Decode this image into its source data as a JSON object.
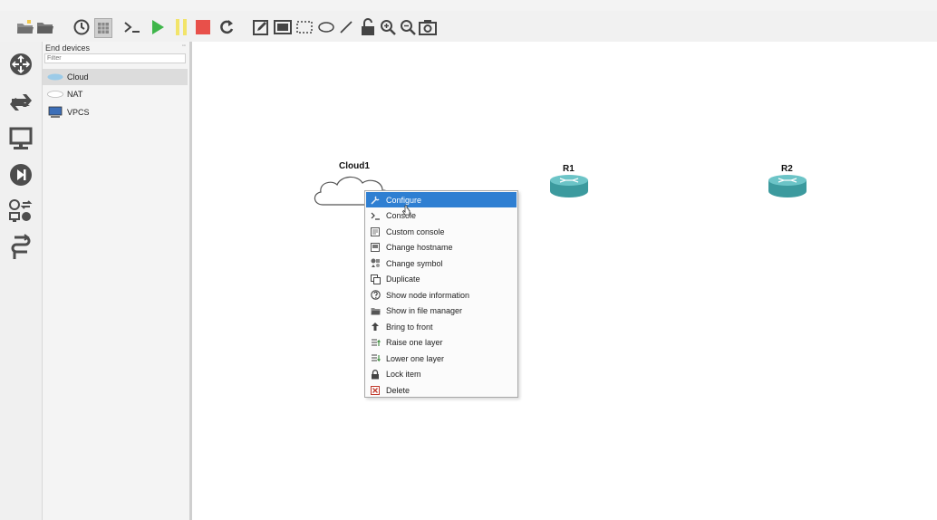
{
  "toolbar": {
    "buttons": [
      {
        "name": "open-project-icon"
      },
      {
        "name": "folder-icon"
      },
      {
        "name": "clock-icon"
      },
      {
        "name": "snapshot-grid-icon"
      },
      {
        "name": "console-icon"
      },
      {
        "name": "start-icon"
      },
      {
        "name": "suspend-icon"
      },
      {
        "name": "stop-icon"
      },
      {
        "name": "reload-icon"
      },
      {
        "name": "note-icon"
      },
      {
        "name": "picture-icon"
      },
      {
        "name": "rectangle-icon"
      },
      {
        "name": "ellipse-icon"
      },
      {
        "name": "line-icon"
      },
      {
        "name": "lock-icon"
      },
      {
        "name": "zoom-in-icon"
      },
      {
        "name": "zoom-out-icon"
      },
      {
        "name": "screenshot-icon"
      }
    ],
    "colors": {
      "start": "#3fb64a",
      "suspend": "#f2e46a",
      "stop": "#e8504a",
      "accent": "#2f7fd2"
    }
  },
  "dock": {
    "items": [
      {
        "name": "routers-icon"
      },
      {
        "name": "switches-icon"
      },
      {
        "name": "end-devices-icon"
      },
      {
        "name": "security-devices-icon"
      },
      {
        "name": "all-devices-icon"
      },
      {
        "name": "add-link-icon"
      }
    ]
  },
  "device_panel": {
    "title": "End devices",
    "controls": "▫▫",
    "filter_placeholder": "Filter",
    "devices": [
      {
        "label": "Cloud",
        "icon": "cloud-icon"
      },
      {
        "label": "NAT",
        "icon": "nat-icon"
      },
      {
        "label": "VPCS",
        "icon": "computer-icon"
      }
    ]
  },
  "canvas": {
    "nodes": [
      {
        "label": "Cloud1",
        "type": "cloud"
      },
      {
        "label": "R1",
        "type": "router"
      },
      {
        "label": "R2",
        "type": "router"
      }
    ]
  },
  "context_menu": {
    "items": [
      {
        "label": "Configure",
        "icon": "wrench-icon"
      },
      {
        "label": "Console",
        "icon": "console-prompt-icon"
      },
      {
        "label": "Custom console",
        "icon": "custom-console-icon"
      },
      {
        "label": "Change hostname",
        "icon": "hostname-icon"
      },
      {
        "label": "Change symbol",
        "icon": "symbol-icon"
      },
      {
        "label": "Duplicate",
        "icon": "duplicate-icon"
      },
      {
        "label": "Show node information",
        "icon": "info-icon"
      },
      {
        "label": "Show in file manager",
        "icon": "folder-open-icon"
      },
      {
        "label": "Bring to front",
        "icon": "bring-front-icon"
      },
      {
        "label": "Raise one layer",
        "icon": "raise-layer-icon"
      },
      {
        "label": "Lower one layer",
        "icon": "lower-layer-icon"
      },
      {
        "label": "Lock item",
        "icon": "padlock-icon"
      },
      {
        "label": "Delete",
        "icon": "delete-icon"
      }
    ]
  }
}
